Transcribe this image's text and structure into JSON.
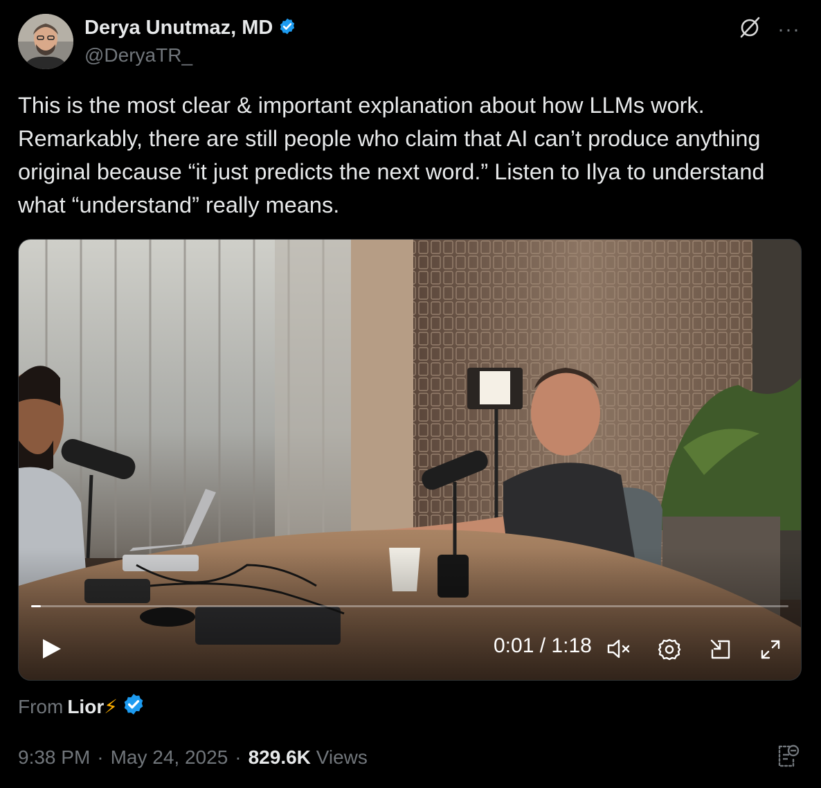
{
  "author": {
    "display_name": "Derya Unutmaz, MD",
    "handle": "@DeryaTR_",
    "verified": true,
    "avatar": "avatar"
  },
  "header_icons": {
    "grok": "grok-icon",
    "more": "···"
  },
  "tweet": {
    "text": "This is the most clear & important explanation about how LLMs work. Remarkably, there are still people who claim that AI can’t produce anything original because “it just predicts the next word.” Listen to Ilya to understand what “understand” really means."
  },
  "video": {
    "current_time": "0:01",
    "separator": "/",
    "duration": "1:18",
    "progress": 0.013,
    "controls": [
      "play-icon",
      "mute-icon",
      "settings-icon",
      "dock-icon",
      "fullscreen-icon"
    ]
  },
  "attribution": {
    "label": "From",
    "name": "Lior",
    "emoji": "⚡",
    "verified": true
  },
  "meta": {
    "time": "9:38 PM",
    "dot1": "·",
    "date": "May 24, 2025",
    "dot2": "·",
    "views_count": "829.6K",
    "views_label": "Views"
  },
  "colors": {
    "background": "#000000",
    "text": "#e7e9ea",
    "secondary": "#71767b",
    "verified": "#1d9bf0"
  }
}
